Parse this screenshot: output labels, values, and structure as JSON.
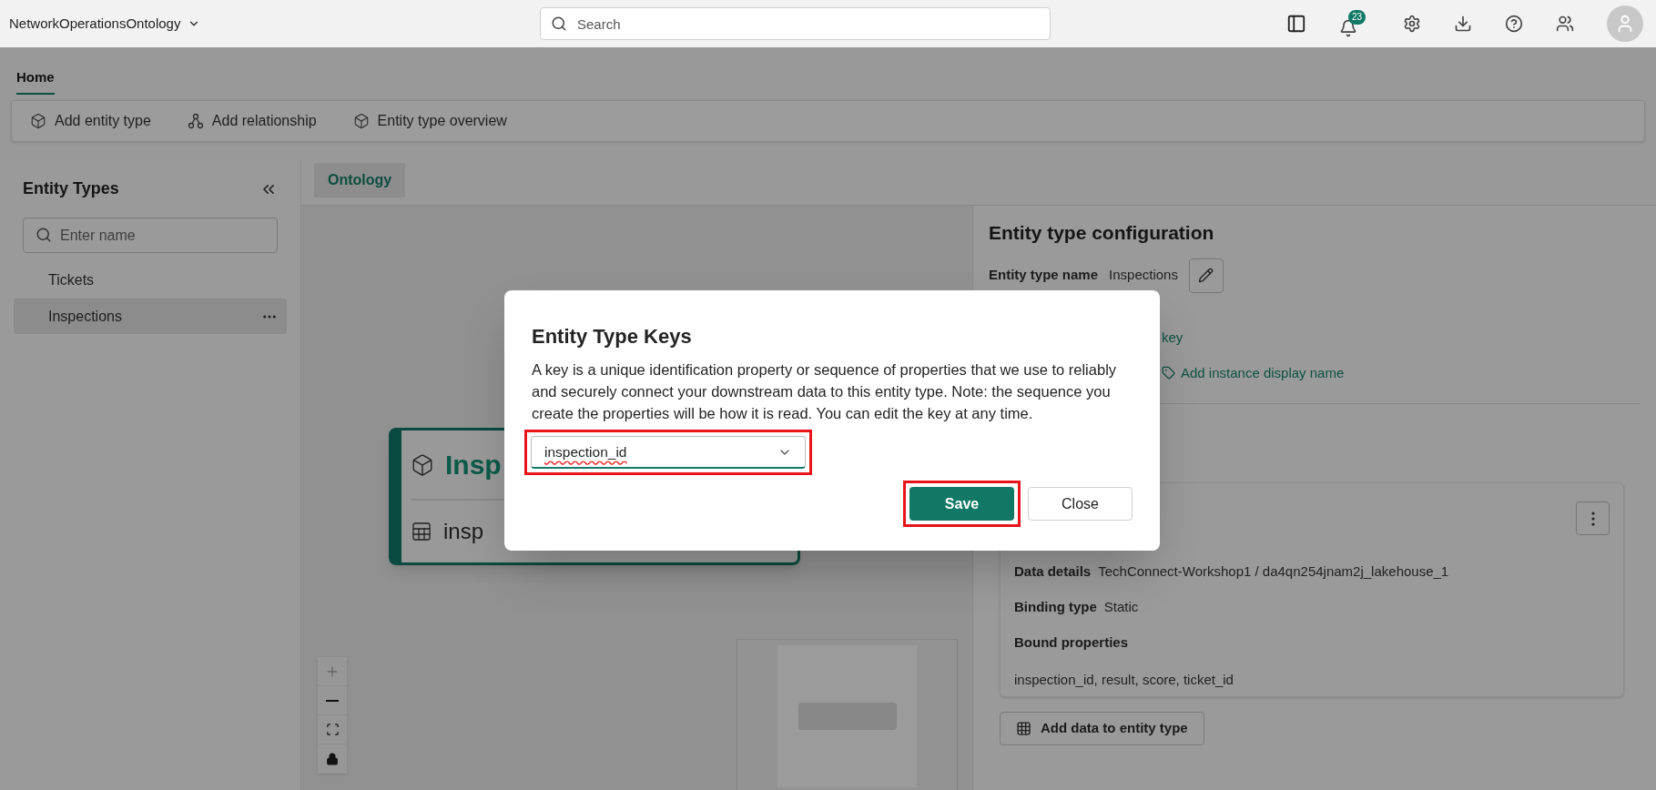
{
  "app": {
    "title": "NetworkOperationsOntology"
  },
  "search": {
    "placeholder": "Search"
  },
  "notifications": {
    "count": "23"
  },
  "ribbon": {
    "tabs": [
      {
        "label": "Home",
        "selected": true
      }
    ],
    "actions": [
      {
        "label": "Add entity type"
      },
      {
        "label": "Add relationship"
      },
      {
        "label": "Entity type overview"
      }
    ]
  },
  "sidebar": {
    "title": "Entity Types",
    "search_placeholder": "Enter name",
    "items": [
      {
        "label": "Tickets",
        "selected": false
      },
      {
        "label": "Inspections",
        "selected": true
      }
    ]
  },
  "canvas": {
    "tabs": [
      {
        "label": "Ontology",
        "selected": true
      }
    ],
    "node": {
      "title": "Insp",
      "property": "insp"
    }
  },
  "config": {
    "title": "Entity type configuration",
    "name_label": "Entity type name",
    "name_value": "Inspections",
    "key_link": "key",
    "display_name_link": "Add instance display name",
    "binding": {
      "rows": [
        {
          "label": "Data details",
          "value": "TechConnect-Workshop1 / da4qn254jnam2j_lakehouse_1"
        },
        {
          "label": "Binding type",
          "value": "Static"
        }
      ],
      "properties_label": "Bound properties",
      "properties": "inspection_id, result, score, ticket_id"
    },
    "add_data_button": "Add data to entity type"
  },
  "dialog": {
    "title": "Entity Type Keys",
    "description": "A key is a unique identification property or sequence of properties that we use to reliably and securely connect your downstream data to this entity type. Note: the sequence you create the properties will be how it is read. You can edit the key at any time.",
    "key_select": {
      "value": "inspection_id",
      "highlighted": true
    },
    "buttons": [
      {
        "label": "Save",
        "kind": "primary",
        "highlighted": true
      },
      {
        "label": "Close",
        "kind": "secondary",
        "highlighted": false
      }
    ]
  }
}
